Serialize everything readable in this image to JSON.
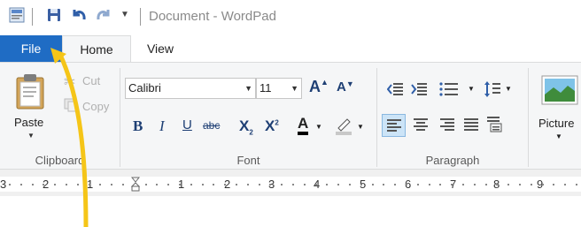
{
  "window": {
    "title": "Document - WordPad"
  },
  "tabs": {
    "file": "File",
    "home": "Home",
    "view": "View"
  },
  "clipboard": {
    "paste": "Paste",
    "cut": "Cut",
    "copy": "Copy",
    "label": "Clipboard"
  },
  "font": {
    "family": "Calibri",
    "size": "11",
    "label": "Font"
  },
  "paragraph": {
    "label": "Paragraph"
  },
  "insert": {
    "picture": "Picture"
  },
  "ruler": {
    "numbers": [
      "3",
      "2",
      "1",
      "1",
      "2",
      "3",
      "4",
      "5",
      "6",
      "7",
      "8",
      "9"
    ]
  },
  "colors": {
    "file_tab": "#1f6cc4",
    "annotation_arrow": "#f5c518",
    "ribbon_bg": "#f5f6f7"
  }
}
